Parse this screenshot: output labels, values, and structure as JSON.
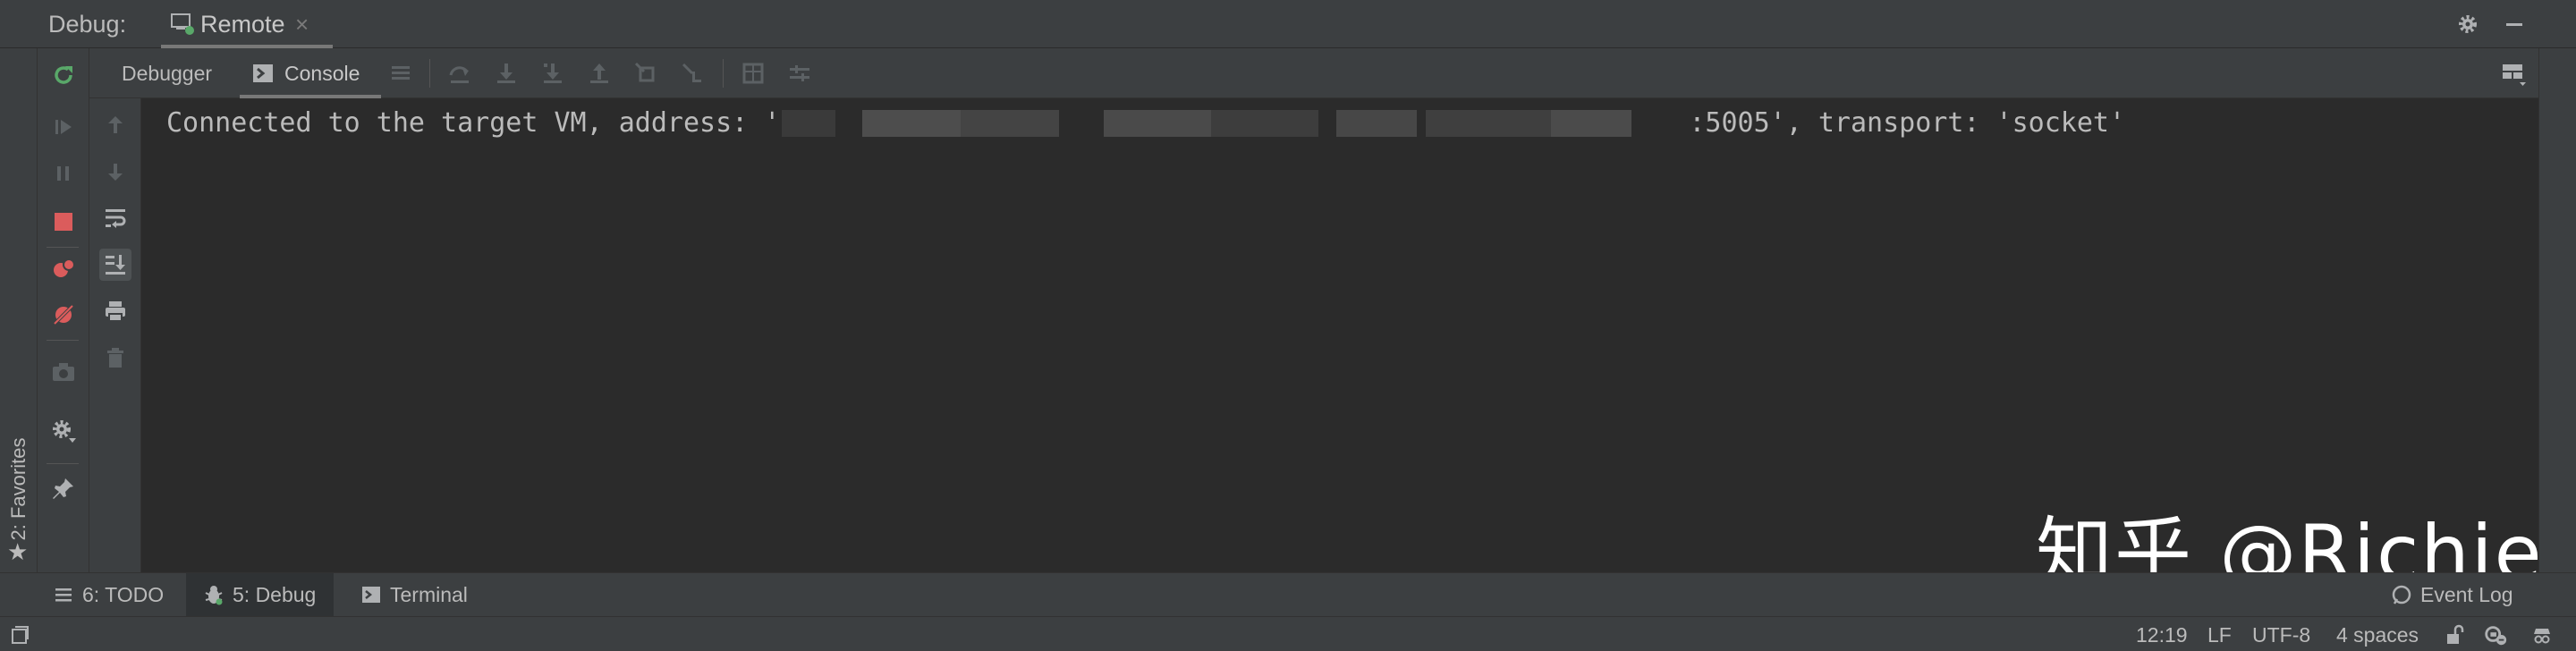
{
  "colors": {
    "background": "#3c3f41",
    "console_background": "#2b2b2b",
    "text": "#bbbbbb",
    "rerun_green": "#59a869",
    "stop_red": "#db5c5c",
    "disabled_icon": "#5c6164",
    "watermark": "#ffffff"
  },
  "titlebar": {
    "label": "Debug:",
    "tab_label": "Remote",
    "tab_close": "×",
    "icons": [
      "remote-debug-icon",
      "gear-icon",
      "minimize-icon"
    ]
  },
  "left_strip": {
    "favorites_label": "2: Favorites",
    "favorites_icon": "star-icon"
  },
  "debug_toolbar": {
    "icons": [
      "rerun-icon",
      "resume-icon",
      "pause-icon",
      "stop-icon",
      "view-breakpoints-icon",
      "mute-breakpoints-icon",
      "camera-icon",
      "settings-icon",
      "pin-icon"
    ]
  },
  "subtabs": {
    "debugger_label": "Debugger",
    "console_label": "Console",
    "console_icon": "console-icon",
    "tool_icons": [
      "show-execution-point-icon",
      "step-over-icon",
      "step-into-icon",
      "force-step-into-icon",
      "step-out-icon",
      "drop-frame-icon",
      "run-to-cursor-icon",
      "evaluate-expression-icon",
      "trace-icon",
      "layout-icon"
    ]
  },
  "console_toolbar": {
    "icons": [
      "up-arrow-icon",
      "down-arrow-icon",
      "soft-wrap-icon",
      "scroll-to-end-icon",
      "print-icon",
      "trash-icon"
    ]
  },
  "console": {
    "prefix": "Connected to the target VM, address: '",
    "suffix": ":5005', transport: 'socket'"
  },
  "watermark": "知乎 @Richie",
  "bottombar": {
    "todo_label": "6: TODO",
    "debug_label": "5: Debug",
    "terminal_label": "Terminal",
    "event_log_label": "Event Log"
  },
  "statusbar": {
    "position": "12:19",
    "line_separator": "LF",
    "encoding": "UTF-8",
    "indent": "4 spaces"
  }
}
